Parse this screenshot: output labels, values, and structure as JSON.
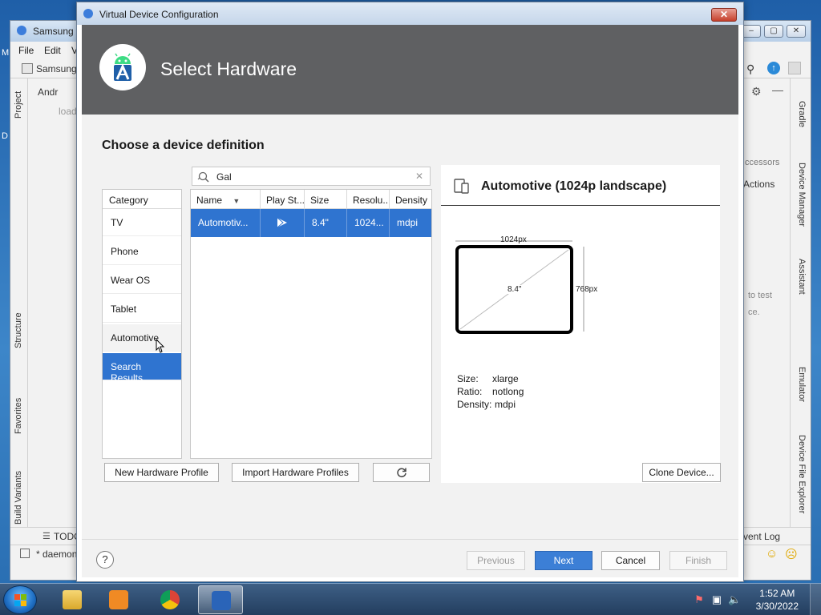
{
  "desktop": {
    "letters": [
      "M",
      "D"
    ]
  },
  "ide": {
    "title": "Samsung G",
    "menu": [
      "File",
      "Edit",
      "V"
    ],
    "toolbar_project": "Samsung",
    "tree_item": "Andr",
    "loading_text": "load",
    "left_tabs": [
      "Project",
      "Structure",
      "Favorites",
      "Build Variants"
    ],
    "right_tabs": [
      "Gradle",
      "Device Manager",
      "Assistant",
      "Emulator",
      "Device File Explorer"
    ],
    "right_panel": {
      "tab_partial": "ccessors",
      "actions_label": "Actions",
      "hint_line1": "to test",
      "hint_line2": "ce."
    },
    "bottom_todo": "TODO",
    "event_log": "vent Log",
    "status_text": "* daemon"
  },
  "dialog": {
    "title": "Virtual Device Configuration",
    "close_label": "✕",
    "banner_title": "Select Hardware",
    "section_title": "Choose a device definition",
    "search": {
      "value": "Gal",
      "clear_label": "✕"
    },
    "category": {
      "header": "Category",
      "items": [
        "TV",
        "Phone",
        "Wear OS",
        "Tablet",
        "Automotive",
        "Search Results"
      ]
    },
    "table": {
      "columns": [
        "Name",
        "Play St...",
        "Size",
        "Resolu...",
        "Density"
      ],
      "sort_indicator": "▼",
      "rows": [
        {
          "name": "Automotiv...",
          "play_store_icon": "play-store-icon",
          "size": "8.4\"",
          "resolution": "1024...",
          "density": "mdpi"
        }
      ]
    },
    "details": {
      "title": "Automotive (1024p landscape)",
      "width_label": "1024px",
      "height_label": "768px",
      "diagonal_label": "8.4\"",
      "specs": [
        {
          "key": "Size:",
          "value": "xlarge"
        },
        {
          "key": "Ratio:",
          "value": "notlong"
        },
        {
          "key": "Density:",
          "value": "mdpi"
        }
      ]
    },
    "buttons": {
      "new_profile": "New Hardware Profile",
      "import_profiles": "Import Hardware Profiles",
      "refresh_icon": "refresh-icon",
      "clone": "Clone Device...",
      "help": "?",
      "previous": "Previous",
      "next": "Next",
      "cancel": "Cancel",
      "finish": "Finish"
    }
  },
  "taskbar": {
    "time": "1:52 AM",
    "date": "3/30/2022"
  },
  "colors": {
    "selection": "#2f74d0",
    "banner": "#5f6062",
    "primary_button": "#3c7fd6"
  }
}
